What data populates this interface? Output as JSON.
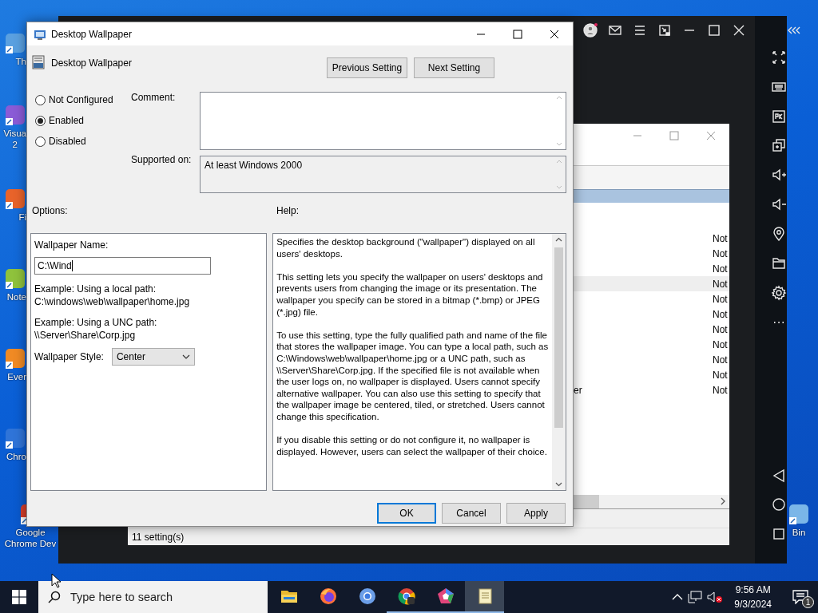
{
  "desktop_icons": [
    {
      "lines": [
        "Th"
      ]
    },
    {
      "lines": [
        "Visua",
        "2"
      ]
    },
    {
      "lines": [
        "Fi"
      ]
    },
    {
      "lines": [
        "Note"
      ]
    },
    {
      "lines": [
        "Ever"
      ]
    },
    {
      "lines": [
        "Chro"
      ]
    },
    {
      "lines": [
        "Google",
        "Chrome Dev"
      ]
    },
    {
      "lines": [
        "Bin"
      ]
    }
  ],
  "background_window": {
    "rows": [
      {
        "name": "",
        "status": "Not",
        "highlighted": false
      },
      {
        "name": "",
        "status": "Not",
        "highlighted": false
      },
      {
        "name": "",
        "status": "Not",
        "highlighted": false
      },
      {
        "name": "",
        "status": "Not",
        "highlighted": true
      },
      {
        "name": "",
        "status": "Not",
        "highlighted": false
      },
      {
        "name": "",
        "status": "Not",
        "highlighted": false
      },
      {
        "name": "",
        "status": "Not",
        "highlighted": false
      },
      {
        "name": "",
        "status": "Not",
        "highlighted": false
      },
      {
        "name": "",
        "status": "Not",
        "highlighted": false
      },
      {
        "name": "",
        "status": "Not",
        "highlighted": false
      },
      {
        "name": "er",
        "status": "Not",
        "highlighted": false
      }
    ],
    "status_bar": "11 setting(s)"
  },
  "dialog": {
    "title": "Desktop Wallpaper",
    "header": "Desktop Wallpaper",
    "nav_buttons": [
      "Previous Setting",
      "Next Setting"
    ],
    "state_options": [
      {
        "label": "Not Configured",
        "selected": false
      },
      {
        "label": "Enabled",
        "selected": true
      },
      {
        "label": "Disabled",
        "selected": false
      }
    ],
    "comment_label": "Comment:",
    "supported_label": "Supported on:",
    "supported_value": "At least Windows 2000",
    "options_label": "Options:",
    "help_label": "Help:",
    "options": {
      "name_label": "Wallpaper Name:",
      "name_value": "C:\\Wind",
      "examples": [
        {
          "label": "Example: Using a local path:",
          "path": "C:\\windows\\web\\wallpaper\\home.jpg"
        },
        {
          "label": "Example: Using a UNC path:",
          "path": "\\\\Server\\Share\\Corp.jpg"
        }
      ],
      "style_label": "Wallpaper Style:",
      "style_value": "Center"
    },
    "help": [
      "Specifies the desktop background (\"wallpaper\") displayed on all users' desktops.",
      "This setting lets you specify the wallpaper on users' desktops and prevents users from changing the image or its presentation. The wallpaper you specify can be stored in a bitmap (*.bmp) or JPEG (*.jpg) file.",
      "To use this setting, type the fully qualified path and name of the file that stores the wallpaper image. You can type a local path, such as C:\\Windows\\web\\wallpaper\\home.jpg or a UNC path, such as \\\\Server\\Share\\Corp.jpg. If the specified file is not available when the user logs on, no wallpaper is displayed. Users cannot specify alternative wallpaper. You can also use this setting to specify that the wallpaper image be centered, tiled, or stretched. Users cannot change this specification.",
      "If you disable this setting or do not configure it, no wallpaper is displayed. However, users can select the wallpaper of their choice."
    ],
    "footer_buttons": [
      {
        "label": "OK",
        "default": true
      },
      {
        "label": "Cancel",
        "default": false
      },
      {
        "label": "Apply",
        "default": false
      }
    ]
  },
  "taskbar": {
    "search_placeholder": "Type here to search",
    "apps": [
      {
        "kind": "explorer",
        "running": false,
        "active": false
      },
      {
        "kind": "firefox",
        "running": false,
        "active": false
      },
      {
        "kind": "chromium",
        "running": false,
        "active": false
      },
      {
        "kind": "chromedev",
        "running": true,
        "active": false
      },
      {
        "kind": "pentagon",
        "running": true,
        "active": false
      },
      {
        "kind": "notepad",
        "running": true,
        "active": true
      }
    ],
    "time": "9:56 AM",
    "date": "9/3/2024",
    "notification_count": "1"
  }
}
